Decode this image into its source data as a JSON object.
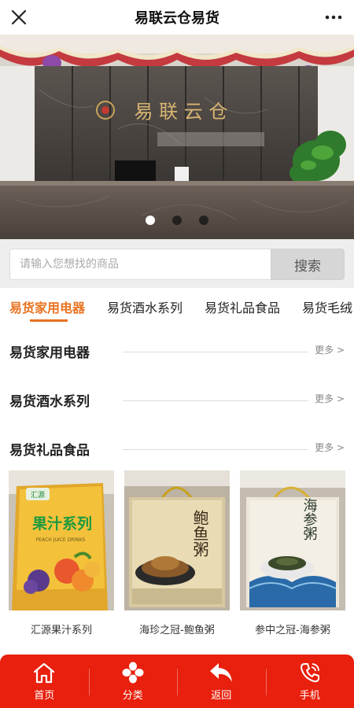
{
  "header": {
    "title": "易联云仓易货"
  },
  "banner": {
    "sign_text": "易 联 云 仓",
    "slides": [
      {},
      {},
      {}
    ],
    "active_slide": 0
  },
  "search": {
    "placeholder": "请输入您想找的商品",
    "button_label": "搜索"
  },
  "tabs": [
    {
      "label": "易货家用电器",
      "active": true
    },
    {
      "label": "易货酒水系列",
      "active": false
    },
    {
      "label": "易货礼品食品",
      "active": false
    },
    {
      "label": "易货毛绒",
      "active": false
    }
  ],
  "sections": [
    {
      "title": "易货家用电器",
      "more": "更多 >"
    },
    {
      "title": "易货酒水系列",
      "more": "更多 >"
    },
    {
      "title": "易货礼品食品",
      "more": "更多 >"
    }
  ],
  "products": [
    {
      "name": "汇源果汁系列",
      "box_text": "果汁系列",
      "brand": "汇源",
      "sub": "PEACH JUICE DRINKS"
    },
    {
      "name": "海珍之冠-鲍鱼粥",
      "box_text": "鲍鱼粥"
    },
    {
      "name": "参中之冠-海参粥",
      "box_text": "海参粥"
    }
  ],
  "bottom_nav": [
    {
      "label": "首页",
      "icon": "home-icon"
    },
    {
      "label": "分类",
      "icon": "category-icon"
    },
    {
      "label": "返回",
      "icon": "back-icon"
    },
    {
      "label": "手机",
      "icon": "phone-icon"
    }
  ],
  "colors": {
    "accent": "#e9721f",
    "nav_bg": "#e8200d"
  }
}
